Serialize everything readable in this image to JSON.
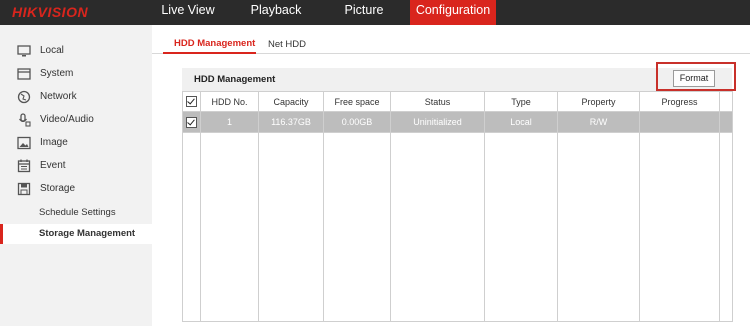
{
  "brand": {
    "logo": "HIKVISION",
    "accent": "#d9251d"
  },
  "nav": [
    {
      "label": "Live View"
    },
    {
      "label": "Playback"
    },
    {
      "label": "Picture"
    },
    {
      "label": "Configuration",
      "active": true
    }
  ],
  "sidebar": {
    "items": [
      {
        "label": "Local",
        "icon": "monitor-icon"
      },
      {
        "label": "System",
        "icon": "system-icon"
      },
      {
        "label": "Network",
        "icon": "globe-icon"
      },
      {
        "label": "Video/Audio",
        "icon": "microphone-icon"
      },
      {
        "label": "Image",
        "icon": "image-icon"
      },
      {
        "label": "Event",
        "icon": "calendar-icon"
      },
      {
        "label": "Storage",
        "icon": "disk-icon"
      }
    ],
    "subitems": [
      {
        "label": "Schedule Settings"
      },
      {
        "label": "Storage Management",
        "active": true
      }
    ]
  },
  "tabs": [
    {
      "label": "HDD Management",
      "active": true
    },
    {
      "label": "Net HDD"
    }
  ],
  "panel": {
    "title": "HDD Management",
    "format_label": "Format"
  },
  "table": {
    "columns": [
      "HDD No.",
      "Capacity",
      "Free space",
      "Status",
      "Type",
      "Property",
      "Progress"
    ],
    "rows": [
      {
        "hdd_no": "1",
        "capacity": "116.37GB",
        "free_space": "0.00GB",
        "status": "Uninitialized",
        "type": "Local",
        "property": "R/W",
        "progress": ""
      }
    ]
  }
}
